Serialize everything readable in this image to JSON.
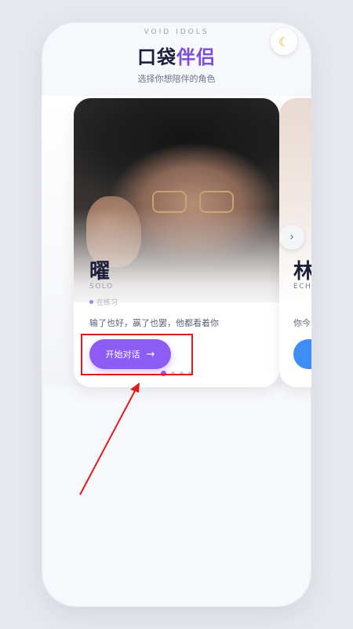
{
  "header": {
    "brand": "VOID IDOLS",
    "title_main": "口袋",
    "title_highlight": "伴侣",
    "subtitle": "选择你想陪伴的角色",
    "theme_icon": "moon-icon"
  },
  "cards": [
    {
      "name": "曜",
      "english_name": "SOLO",
      "status": "在练习",
      "quote": "输了也好，赢了也罢，他都看着你",
      "button_label": "开始对话",
      "button_icon": "arrow-right-icon",
      "button_color": "#8d5cf5"
    },
    {
      "name": "林",
      "english_name": "ECH",
      "quote": "你今",
      "button_color": "#3d8df5"
    }
  ],
  "carousel": {
    "next_icon": "chevron-right-icon",
    "page_count": 4,
    "active_index": 0
  },
  "annotation": {
    "color": "#e11b1b"
  },
  "colors": {
    "accent": "#8d5cf5",
    "title_highlight": "#7c4ddc"
  }
}
